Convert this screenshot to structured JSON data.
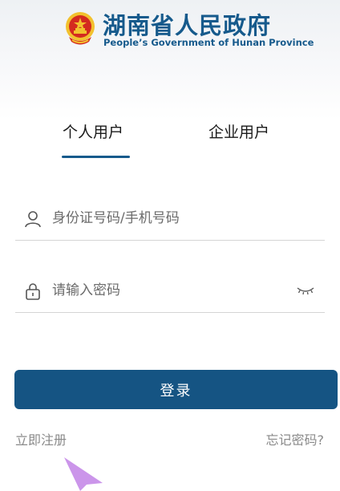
{
  "header": {
    "title_cn": "湖南省人民政府",
    "title_en": "People’s Government of Hunan Province",
    "emblem_icon": "national-emblem-icon"
  },
  "tabs": [
    {
      "label": "个人用户",
      "selected": true
    },
    {
      "label": "企业用户",
      "selected": false
    }
  ],
  "form": {
    "username": {
      "placeholder": "身份证号码/手机号码",
      "value": "",
      "icon": "user-icon"
    },
    "password": {
      "placeholder": "请输入密码",
      "value": "",
      "icon": "lock-icon",
      "toggle_icon": "eye-closed-icon"
    }
  },
  "login_button": {
    "label": "登录"
  },
  "links": {
    "register": "立即注册",
    "forgot": "忘记密码?"
  },
  "colors": {
    "brand": "#165a8c",
    "button": "#155483",
    "emblem_red": "#d42a1f",
    "emblem_gold": "#f2c12e",
    "cursor": "#c58ae8"
  }
}
